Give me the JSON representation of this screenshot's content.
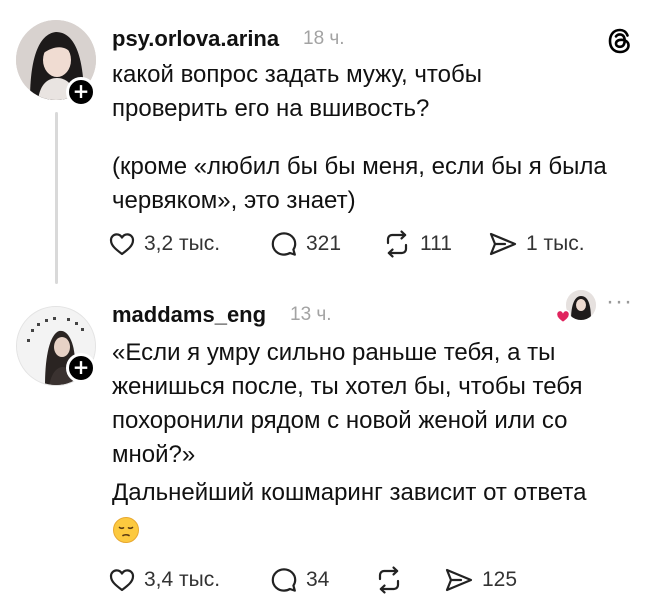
{
  "posts": [
    {
      "username": "psy.orlova.arina",
      "time": "18 ч.",
      "body": [
        "какой вопрос задать мужу, чтобы\nпроверить его на вшивость?",
        "(кроме «любил бы бы меня, если бы я была\nчервяком», это знает)"
      ],
      "actions": {
        "likes": "3,2 тыс.",
        "comments": "321",
        "reposts": "111",
        "shares": "1 тыс."
      }
    },
    {
      "username": "maddams_eng",
      "time": "13 ч.",
      "body": [
        "«Если я умру сильно раньше тебя, а ты\nженишься после, ты хотел бы, чтобы тебя\nпохоронили рядом с новой женой или со\nмной?»",
        "Дальнейший кошмаринг зависит от ответа"
      ],
      "actions": {
        "likes": "3,4 тыс.",
        "comments": "34",
        "shares": "125"
      }
    }
  ],
  "icons": {
    "follow": "plus-icon",
    "app": "threads-logo-icon",
    "like": "heart-icon",
    "comment": "comment-bubble-icon",
    "repost": "repost-icon",
    "share": "send-icon",
    "more": "more-icon",
    "emoji": "pensive-face-emoji"
  },
  "colors": {
    "text": "#111111",
    "muted": "#a3a3a3",
    "thread_line": "#d9d9d9",
    "liked_heart": "#e0245e"
  }
}
